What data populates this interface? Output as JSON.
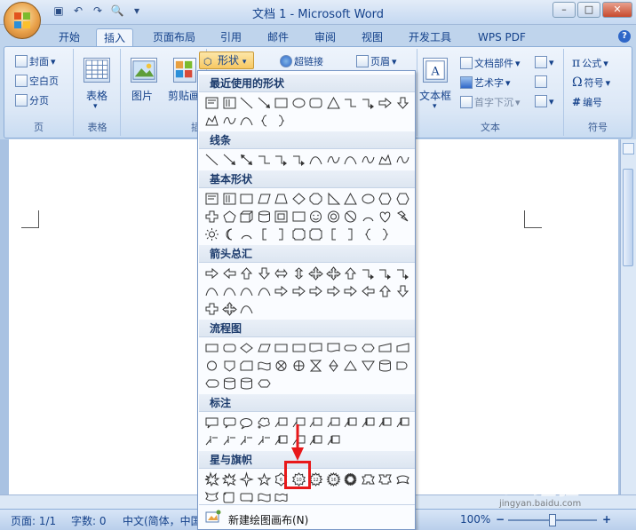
{
  "window": {
    "title": "文档 1 - Microsoft Word",
    "controls": [
      "–",
      "□",
      "✕"
    ]
  },
  "tabs": [
    "开始",
    "插入",
    "页面布局",
    "引用",
    "邮件",
    "审阅",
    "视图",
    "开发工具",
    "WPS PDF"
  ],
  "active_tab": "插入",
  "ribbon": {
    "page_group": {
      "items": [
        "封面",
        "空白页",
        "分页"
      ],
      "label": "页"
    },
    "table_group": {
      "button": "表格",
      "label": "表格"
    },
    "illustrations_group": {
      "buttons": [
        "图片",
        "剪贴画"
      ],
      "label_partial": "插",
      "shapes_button": "形状"
    },
    "links_group": {
      "hyperlink": "超链接"
    },
    "header_group": {
      "header": "页眉"
    },
    "text_group": {
      "textbox": "文本框",
      "items": [
        "文档部件",
        "艺术字",
        "首字下沉"
      ],
      "label": "文本"
    },
    "symbols_group": {
      "items": [
        "公式",
        "符号",
        "编号"
      ],
      "label": "符号"
    }
  },
  "shapes_menu": {
    "sections": [
      {
        "title": "最近使用的形状"
      },
      {
        "title": "线条"
      },
      {
        "title": "基本形状"
      },
      {
        "title": "箭头总汇"
      },
      {
        "title": "流程图"
      },
      {
        "title": "标注"
      },
      {
        "title": "星与旗帜"
      }
    ],
    "footer": "新建绘图画布(N)"
  },
  "statusbar": {
    "page": "页面: 1/1",
    "words": "字数: 0",
    "language": "中文(简体，中国",
    "zoom": "100%"
  },
  "watermark": {
    "main": "Bai 经验",
    "sub": "jingyan.baidu.com"
  },
  "colors": {
    "ribbon": "#dbe7f6",
    "accent": "#15428b",
    "highlight": "#e8181a"
  }
}
